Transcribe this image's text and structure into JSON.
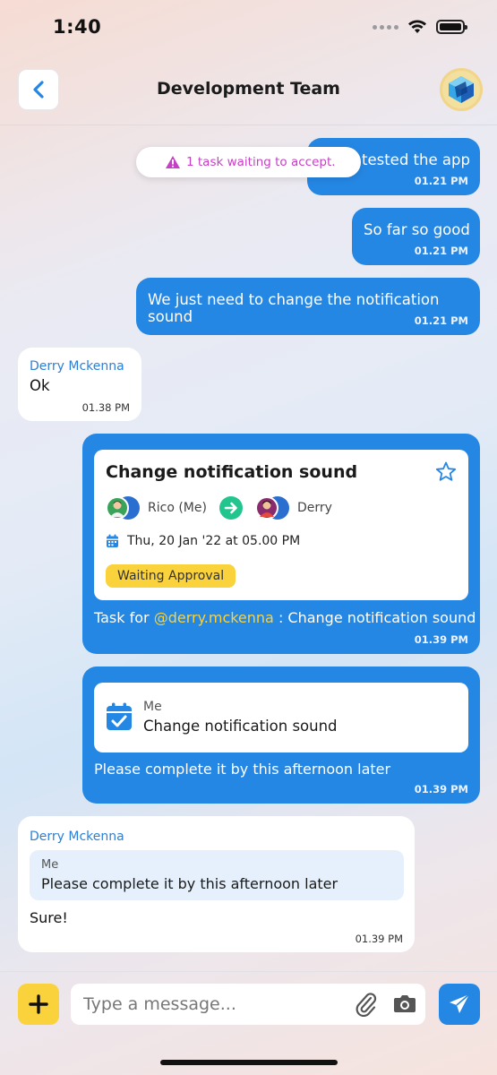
{
  "status_bar": {
    "time": "1:40"
  },
  "header": {
    "title": "Development Team"
  },
  "toast": {
    "text": "1 task waiting to accept."
  },
  "messages": {
    "m1": {
      "text": "tested the app",
      "time": "01.21 PM"
    },
    "m2": {
      "text": "So far so good",
      "time": "01.21 PM"
    },
    "m3": {
      "text": "We just need to change the notification sound",
      "time": "01.21 PM"
    },
    "m4": {
      "sender": "Derry Mckenna",
      "text": "Ok",
      "time": "01.38 PM"
    },
    "m5": {
      "task": {
        "title": "Change notification sound",
        "from": "Rico (Me)",
        "to": "Derry",
        "date": "Thu, 20 Jan '22 at 05.00 PM",
        "status": "Waiting Approval"
      },
      "prefix": "Task for ",
      "mention": "@derry.mckenna",
      "suffix": " : Change notification sound",
      "time": "01.39 PM"
    },
    "m6": {
      "ref": {
        "owner": "Me",
        "title": "Change notification sound"
      },
      "text": "Please complete it by this afternoon later",
      "time": "01.39 PM"
    },
    "m7": {
      "sender": "Derry Mckenna",
      "quote": {
        "author": "Me",
        "text": "Please complete it by this afternoon later"
      },
      "text": "Sure!",
      "time": "01.39 PM"
    }
  },
  "composer": {
    "placeholder": "Type a message..."
  },
  "colors": {
    "accent": "#2587e4",
    "yellow": "#f9d23c",
    "mention": "#f9d23c",
    "warning": "#c640c6",
    "sender": "#2b7fd8"
  },
  "icons": [
    "back-chevron-icon",
    "group-logo-icon",
    "warning-icon",
    "star-icon",
    "arrow-right-icon",
    "calendar-icon",
    "calendar-check-icon",
    "plus-icon",
    "paperclip-icon",
    "camera-icon",
    "send-icon"
  ]
}
